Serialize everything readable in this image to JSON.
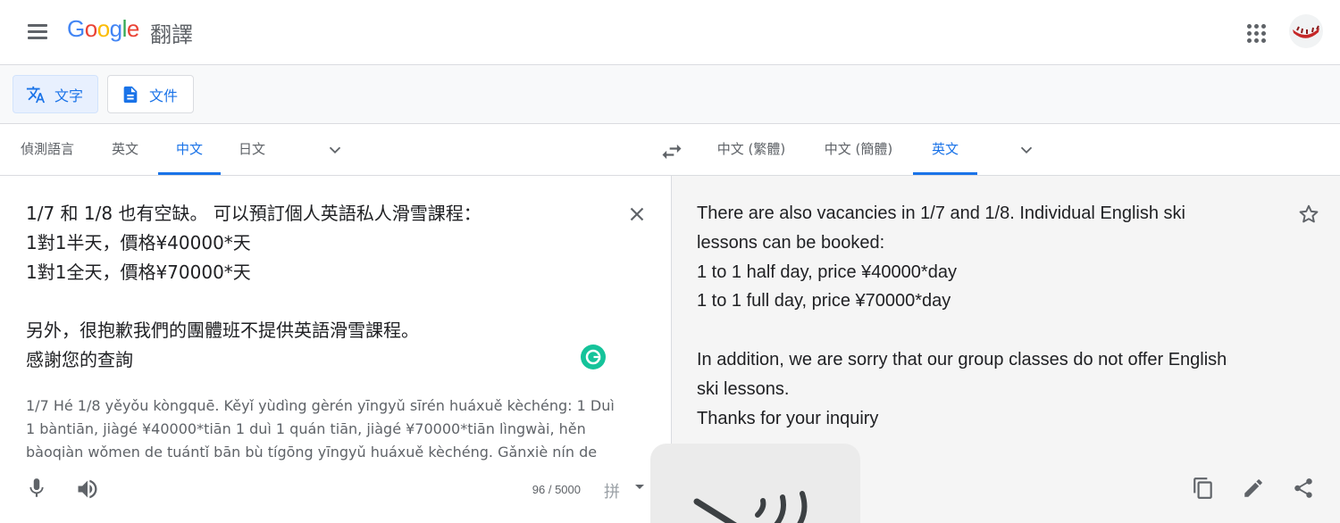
{
  "header": {
    "logo_text": "Google",
    "product_name": "翻譯",
    "menu_icon": "hamburger-menu-icon",
    "apps_icon": "apps-grid-icon",
    "avatar_icon": "account-avatar-icon"
  },
  "modes": [
    {
      "label": "文字",
      "icon": "translate-text-icon",
      "active": true
    },
    {
      "label": "文件",
      "icon": "document-icon",
      "active": false
    }
  ],
  "source_langs": [
    {
      "label": "偵測語言",
      "active": false
    },
    {
      "label": "英文",
      "active": false
    },
    {
      "label": "中文",
      "active": true
    },
    {
      "label": "日文",
      "active": false
    }
  ],
  "target_langs": [
    {
      "label": "中文 (繁體)",
      "active": false
    },
    {
      "label": "中文 (簡體)",
      "active": false
    },
    {
      "label": "英文",
      "active": true
    }
  ],
  "source": {
    "text": "1/7 和 1/8 也有空缺。 可以預訂個人英語私人滑雪課程：\n1對1半天，價格¥40000*天\n1對1全天，價格¥70000*天\n\n另外，很抱歉我們的團體班不提供英語滑雪課程。\n感謝您的查詢",
    "transliteration": "1/7 Hé 1/8 yěyǒu kòngquē. Kěyǐ yùdìng gèrén yīngyǔ sīrén huáxuě kèchéng: 1 Duì 1 bàntiān, jiàgé ¥40000*tiān 1 duì 1 quán tiān, jiàgé ¥70000*tiān lìngwài, hěn bàoqiàn wǒmen de tuántǐ bān bù tígōng yīngyǔ huáxuě kèchéng. Gǎnxiè nín de cháxún",
    "char_count": "96 / 5000",
    "ime_label": "拼"
  },
  "target": {
    "text": "There are also vacancies in 1/7 and 1/8. Individual English ski\nlessons can be booked:\n1 to 1 half day, price ¥40000*day\n1 to 1 full day, price ¥70000*day\n\nIn addition, we are sorry that our group classes do not offer English\nski lessons.\nThanks for your inquiry"
  },
  "colors": {
    "accent": "#1a73e8",
    "text": "#202124",
    "secondary": "#5f6368",
    "target_bg": "#f5f5f5"
  }
}
